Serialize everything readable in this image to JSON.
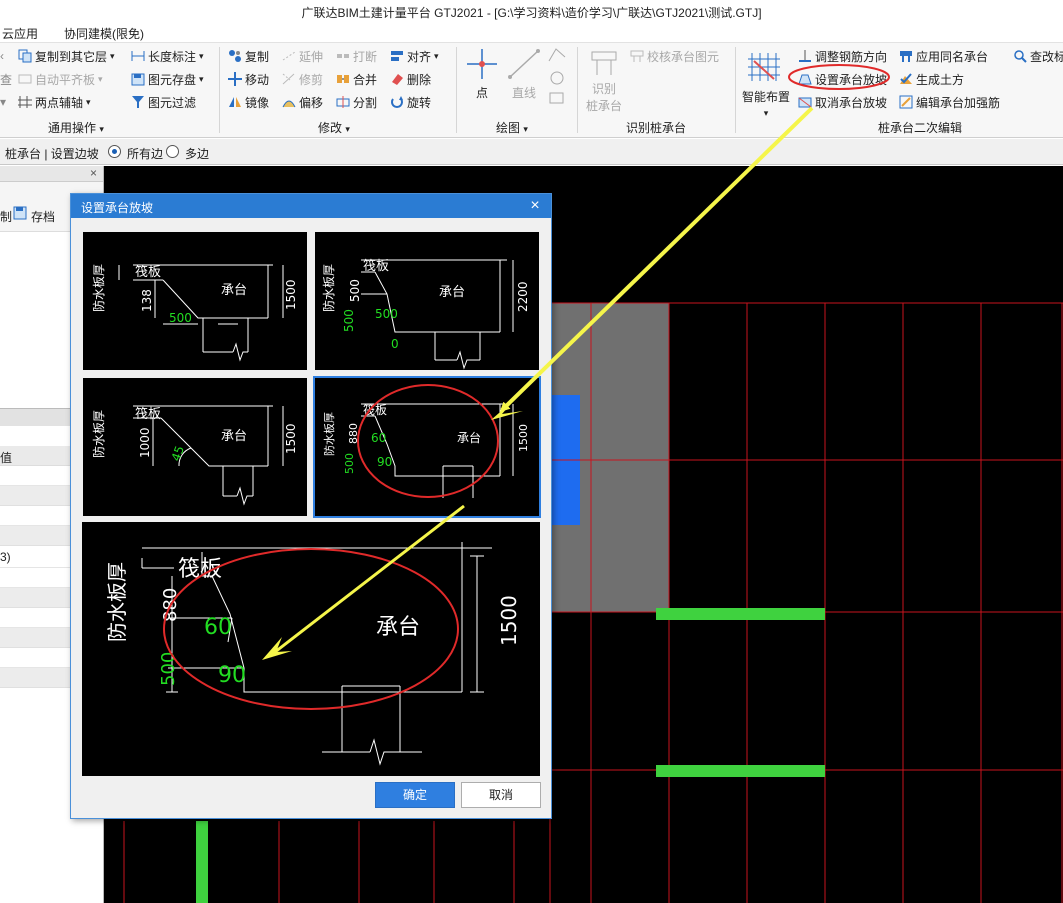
{
  "window": {
    "title": "广联达BIM土建计量平台 GTJ2021 - [G:\\学习资料\\造价学习\\广联达\\GTJ2021\\测试.GTJ]"
  },
  "menu": {
    "items": [
      "云应用",
      "协同建模(限免)"
    ]
  },
  "ribbon": {
    "general": {
      "label": "通用操作",
      "copy_to_floor": "复制到其它层",
      "auto_align": "自动平齐板",
      "two_point_aux": "两点辅轴",
      "length_mark": "长度标注",
      "elem_save": "图元存盘",
      "elem_filter": "图元过滤"
    },
    "modify": {
      "label": "修改",
      "copy": "复制",
      "extend": "延伸",
      "break": "打断",
      "align": "对齐",
      "move": "移动",
      "trim": "修剪",
      "merge": "合并",
      "delete": "删除",
      "mirror": "镜像",
      "offset": "偏移",
      "split": "分割",
      "rotate": "旋转"
    },
    "draw": {
      "label": "绘图",
      "point": "点",
      "line": "直线"
    },
    "recognize": {
      "label": "识别桩承台",
      "recognize_l1": "识别",
      "recognize_l2": "桩承台",
      "check": "校核承台图元"
    },
    "secondary": {
      "label": "桩承台二次编辑",
      "smart_layout": "智能布置",
      "adjust_rebar": "调整钢筋方向",
      "set_slope": "设置承台放坡",
      "cancel_slope": "取消承台放坡",
      "apply_same": "应用同名承台",
      "gen_earth": "生成土方",
      "edit_rebar": "编辑承台加强筋",
      "check_change": "查改标"
    }
  },
  "optbar": {
    "text": "桩承台 | 设置边坡",
    "all_edges": "所有边",
    "multi_edges": "多边",
    "selected": "all_edges"
  },
  "left_panel": {
    "tool_a": "制",
    "save": "存档",
    "value_header": "值",
    "value_row": "3)"
  },
  "dialog": {
    "title": "设置承台放坡",
    "ok": "确定",
    "cancel": "取消",
    "selected_option": 4,
    "options": [
      {
        "waterproof": "防水板厚",
        "raft": "筏板",
        "cap": "承台",
        "height": "1500",
        "dim1": "138",
        "dim2": "500"
      },
      {
        "waterproof": "防水板厚",
        "raft": "筏板",
        "cap": "承台",
        "height": "2200",
        "dim1": "500",
        "dim2": "500",
        "dim3": "500",
        "dim4": "0"
      },
      {
        "waterproof": "防水板厚",
        "raft": "筏板",
        "cap": "承台",
        "height": "1500",
        "dim1": "1000",
        "angle": "45"
      },
      {
        "waterproof": "防水板厚",
        "raft": "筏板",
        "cap": "承台",
        "height": "1500",
        "dim1": "880",
        "dim2": "500",
        "angle1": "60",
        "angle2": "90"
      }
    ],
    "preview": {
      "waterproof": "防水板厚",
      "raft": "筏板",
      "cap": "承台",
      "height": "1500",
      "dim1": "880",
      "dim2": "500",
      "angle1": "60",
      "angle2": "90"
    }
  },
  "colors": {
    "accent": "#2b7cd3",
    "highlight_red": "#e02a2a",
    "arrow_yellow": "#f5f54a",
    "grid_red": "#c8141e",
    "slab_green": "#3fd23f",
    "cad_green": "#22dd22"
  }
}
